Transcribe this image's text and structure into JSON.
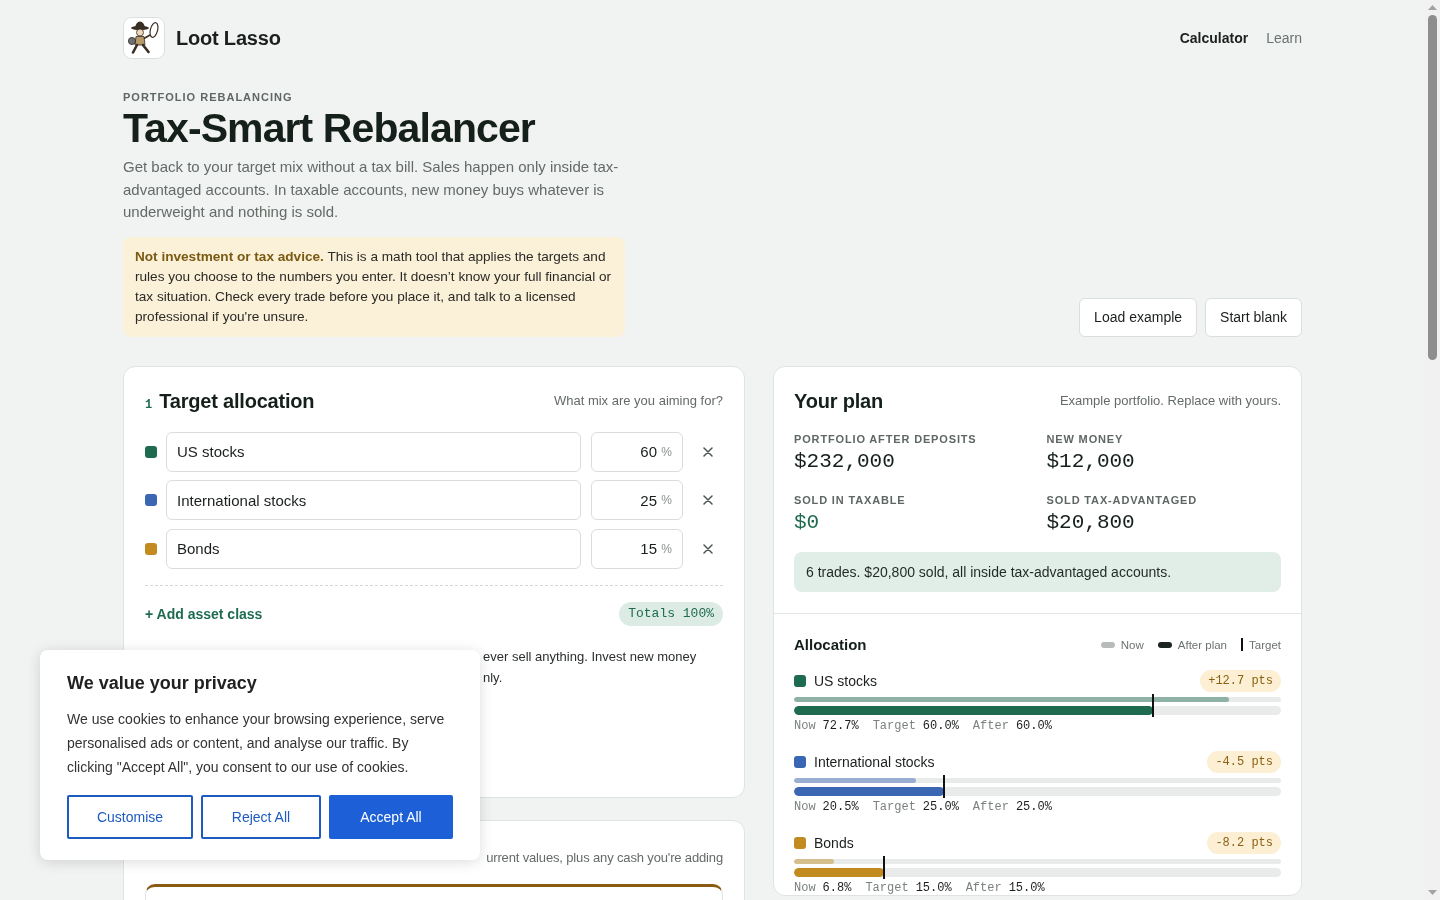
{
  "header": {
    "brand": "Loot Lasso",
    "nav": [
      {
        "label": "Calculator",
        "selected": true
      },
      {
        "label": "Learn",
        "selected": false
      }
    ]
  },
  "hero": {
    "eyebrow": "PORTFOLIO REBALANCING",
    "title": "Tax-Smart Rebalancer",
    "description": "Get back to your target mix without a tax bill. Sales happen only inside tax-advantaged accounts. In taxable accounts, new money buys whatever is underweight and nothing is sold.",
    "disclaimer": "**Not investment or tax advice.** This is a math tool that applies the targets and rules you choose to the numbers you enter. It doesn’t know your full financial or tax situation. Check every trade before you place it, and talk to a licensed professional if you're unsure.",
    "actions": [
      "Load example",
      "Start blank"
    ]
  },
  "target_allocation": {
    "step": "1",
    "title": "Target allocation",
    "hint": "What mix are you aiming for?",
    "rows": [
      {
        "name": "US stocks",
        "percent": "60",
        "unit": "%",
        "color": "#1f6b4f"
      },
      {
        "name": "International stocks",
        "percent": "25",
        "unit": "%",
        "color": "#3a66b4"
      },
      {
        "name": "Bonds",
        "percent": "15",
        "unit": "%",
        "color": "#c28a1f"
      }
    ],
    "add_label": "+ Add asset class",
    "totals": "Totals 100%",
    "option_lines": [
      "ever sell anything. Invest new money",
      "nly."
    ]
  },
  "accounts": {
    "hint": "urrent values, plus any cash you're adding"
  },
  "plan": {
    "title": "Your plan",
    "hint": "Example portfolio. Replace with yours.",
    "stats": [
      {
        "label": "PORTFOLIO AFTER DEPOSITS",
        "value": "$232,000",
        "kind": "plain"
      },
      {
        "label": "NEW MONEY",
        "value": "$12,000",
        "kind": "plain"
      },
      {
        "label": "SOLD IN TAXABLE",
        "value": "$0",
        "kind": "positive"
      },
      {
        "label": "SOLD TAX-ADVANTAGED",
        "value": "$20,800",
        "kind": "plain"
      }
    ],
    "summary": "6 trades. $20,800 sold, all inside tax-advantaged accounts.",
    "allocation": {
      "title": "Allocation",
      "legend": [
        {
          "label": "Now",
          "kind": "now"
        },
        {
          "label": "After plan",
          "kind": "after"
        },
        {
          "label": "Target",
          "kind": "target"
        }
      ],
      "assets": [
        {
          "name": "US stocks",
          "color": "#1f6b4f",
          "delta": "+12.7 pts",
          "now_bar": {
            "level": 0.893
          },
          "after_bar": {
            "level": 0.737
          },
          "target_marker": {
            "level": 0.737
          },
          "figures": [
            {
              "label": "Now",
              "value": "72.7%"
            },
            {
              "label": "Target",
              "value": "60.0%"
            },
            {
              "label": "After",
              "value": "60.0%"
            }
          ]
        },
        {
          "name": "International stocks",
          "color": "#3a66b4",
          "delta": "-4.5 pts",
          "now_bar": {
            "level": 0.25
          },
          "after_bar": {
            "level": 0.307
          },
          "target_marker": {
            "level": 0.307
          },
          "figures": [
            {
              "label": "Now",
              "value": "20.5%"
            },
            {
              "label": "Target",
              "value": "25.0%"
            },
            {
              "label": "After",
              "value": "25.0%"
            }
          ]
        },
        {
          "name": "Bonds",
          "color": "#c28a1f",
          "delta": "-8.2 pts",
          "now_bar": {
            "level": 0.082
          },
          "after_bar": {
            "level": 0.184
          },
          "target_marker": {
            "level": 0.184
          },
          "figures": [
            {
              "label": "Now",
              "value": "6.8%"
            },
            {
              "label": "Target",
              "value": "15.0%"
            },
            {
              "label": "After",
              "value": "15.0%"
            }
          ]
        }
      ]
    }
  },
  "cookie_banner": {
    "title": "We value your privacy",
    "body": "We use cookies to enhance your browsing experience, serve personalised ads or content, and analyse our traffic. By clicking \"Accept All\", you consent to our use of cookies.",
    "buttons": [
      {
        "label": "Customise",
        "kind": "outline"
      },
      {
        "label": "Reject All",
        "kind": "outline"
      },
      {
        "label": "Accept All",
        "kind": "solid"
      }
    ]
  }
}
